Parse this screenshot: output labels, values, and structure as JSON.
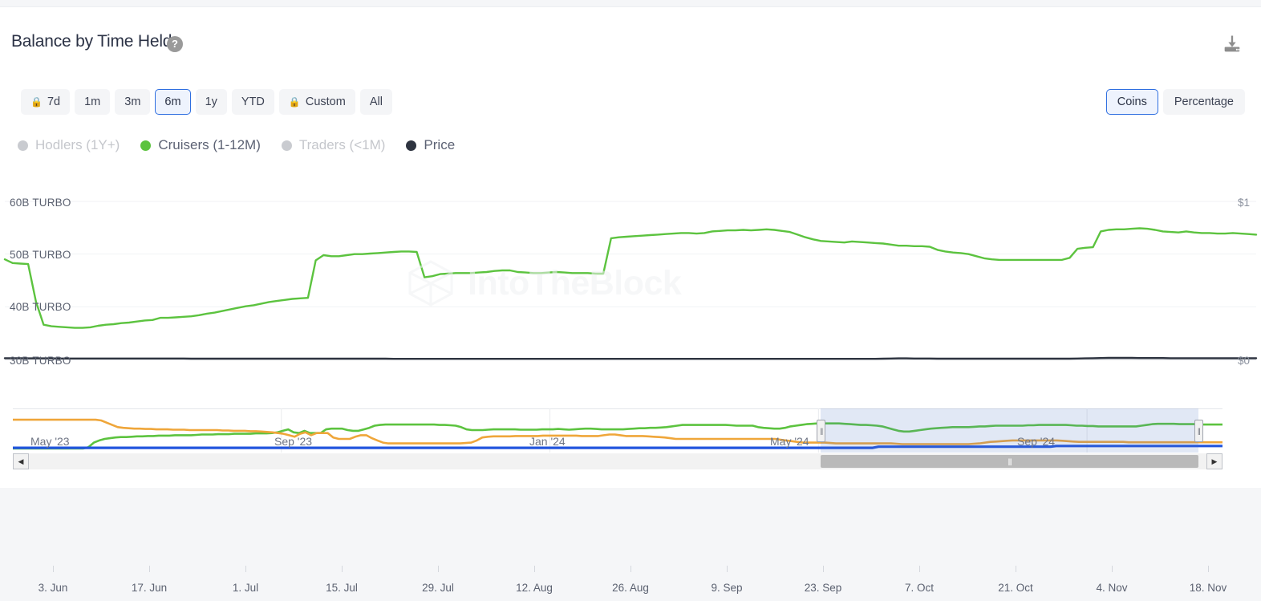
{
  "header": {
    "title": "Balance by Time Held",
    "help_icon": "question-mark-icon",
    "download_icon": "download-icon"
  },
  "toolbar": {
    "ranges": [
      {
        "label": "7d",
        "locked": true,
        "selected": false
      },
      {
        "label": "1m",
        "locked": false,
        "selected": false
      },
      {
        "label": "3m",
        "locked": false,
        "selected": false
      },
      {
        "label": "6m",
        "locked": false,
        "selected": true
      },
      {
        "label": "1y",
        "locked": false,
        "selected": false
      },
      {
        "label": "YTD",
        "locked": false,
        "selected": false
      },
      {
        "label": "Custom",
        "locked": true,
        "selected": false
      },
      {
        "label": "All",
        "locked": false,
        "selected": false
      }
    ],
    "lock_glyph": "🔒",
    "units": [
      {
        "label": "Coins",
        "selected": true
      },
      {
        "label": "Percentage",
        "selected": false
      }
    ]
  },
  "legend": [
    {
      "label": "Hodlers (1Y+)",
      "color": "#c9cbd0",
      "active": false
    },
    {
      "label": "Cruisers (1-12M)",
      "color": "#5cc33f",
      "active": true
    },
    {
      "label": "Traders (<1M)",
      "color": "#c9cbd0",
      "active": false
    },
    {
      "label": "Price",
      "color": "#2e3440",
      "active": true
    }
  ],
  "watermark": {
    "text": "IntoTheBlock"
  },
  "chart_data": {
    "type": "line",
    "title": "Balance by Time Held",
    "xlabel": "",
    "ylabel": "TURBO",
    "ylim": [
      30,
      60
    ],
    "y_ticks": [
      "30B TURBO",
      "40B TURBO",
      "50B TURBO",
      "60B TURBO"
    ],
    "y_tick_values": [
      30,
      40,
      50,
      60
    ],
    "price_axis_label": "Price",
    "price_ticks": [
      "$0",
      "$1"
    ],
    "price_tick_values": [
      0,
      1
    ],
    "price_ylim": [
      0,
      1
    ],
    "grid": true,
    "legend_position": "top-left",
    "x_ticks": [
      "3. Jun",
      "17. Jun",
      "1. Jul",
      "15. Jul",
      "29. Jul",
      "12. Aug",
      "26. Aug",
      "9. Sep",
      "23. Sep",
      "7. Oct",
      "21. Oct",
      "4. Nov",
      "18. Nov"
    ],
    "series": [
      {
        "name": "Cruisers (1-12M)",
        "color": "#5cc33f",
        "unit": "B TURBO",
        "visible": true,
        "values": [
          49.0,
          48.3,
          48.2,
          48.1,
          41.0,
          36.6,
          36.3,
          36.2,
          36.1,
          36.0,
          36.0,
          36.1,
          36.4,
          36.6,
          36.7,
          36.9,
          37.0,
          37.2,
          37.4,
          37.5,
          37.9,
          37.9,
          38.0,
          38.1,
          38.2,
          38.4,
          38.7,
          38.9,
          39.2,
          39.5,
          39.8,
          40.1,
          40.3,
          40.6,
          40.9,
          41.1,
          41.3,
          41.5,
          41.6,
          41.7,
          48.8,
          49.8,
          49.6,
          49.6,
          49.8,
          50.0,
          50.0,
          50.1,
          50.2,
          50.3,
          50.4,
          50.5,
          50.5,
          50.4,
          45.6,
          45.8,
          46.2,
          46.3,
          46.4,
          46.4,
          46.4,
          46.5,
          46.6,
          46.8,
          46.9,
          46.9,
          46.6,
          46.5,
          46.4,
          46.4,
          46.5,
          46.6,
          46.5,
          46.4,
          46.4,
          46.4,
          46.3,
          46.3,
          53.0,
          53.2,
          53.3,
          53.4,
          53.5,
          53.6,
          53.7,
          53.8,
          53.9,
          54.0,
          54.0,
          53.9,
          54.0,
          54.3,
          54.4,
          54.5,
          54.5,
          54.6,
          54.5,
          54.6,
          54.7,
          54.6,
          54.4,
          54.2,
          53.7,
          53.2,
          52.8,
          52.5,
          52.4,
          52.3,
          52.2,
          52.4,
          52.3,
          52.2,
          52.1,
          52.0,
          51.8,
          51.6,
          51.6,
          51.5,
          51.5,
          51.4,
          50.8,
          50.5,
          50.3,
          50.2,
          50.0,
          49.6,
          49.2,
          49.0,
          48.9,
          48.9,
          48.9,
          48.9,
          48.9,
          48.9,
          48.9,
          48.9,
          48.9,
          49.3,
          51.0,
          51.2,
          51.3,
          54.3,
          54.6,
          54.7,
          54.7,
          54.8,
          54.9,
          54.8,
          54.6,
          54.3,
          54.2,
          54.1,
          54.3,
          54.1,
          54.0,
          54.0,
          53.9,
          53.9,
          54.0,
          53.9,
          53.8,
          53.7
        ]
      },
      {
        "name": "Price",
        "color": "#2e3440",
        "unit": "$",
        "visible": true,
        "values": [
          0.008,
          0.008,
          0.008,
          0.007,
          0.007,
          0.007,
          0.007,
          0.006,
          0.006,
          0.006,
          0.006,
          0.006,
          0.006,
          0.006,
          0.006,
          0.006,
          0.006,
          0.006,
          0.006,
          0.006,
          0.006,
          0.006,
          0.006,
          0.006,
          0.005,
          0.005,
          0.005,
          0.005,
          0.005,
          0.005,
          0.005,
          0.005,
          0.005,
          0.005,
          0.005,
          0.005,
          0.005,
          0.005,
          0.005,
          0.005,
          0.005,
          0.005,
          0.005,
          0.005,
          0.005,
          0.005,
          0.005,
          0.005,
          0.005,
          0.005,
          0.004,
          0.004,
          0.004,
          0.004,
          0.004,
          0.004,
          0.004,
          0.004,
          0.004,
          0.004,
          0.004,
          0.004,
          0.004,
          0.004,
          0.004,
          0.004,
          0.004,
          0.004,
          0.004,
          0.004,
          0.004,
          0.004,
          0.004,
          0.004,
          0.004,
          0.004,
          0.004,
          0.004,
          0.004,
          0.004,
          0.004,
          0.004,
          0.004,
          0.004,
          0.004,
          0.004,
          0.004,
          0.004,
          0.004,
          0.004,
          0.004,
          0.004,
          0.004,
          0.004,
          0.004,
          0.004,
          0.004,
          0.004,
          0.004,
          0.004,
          0.004,
          0.004,
          0.004,
          0.004,
          0.004,
          0.004,
          0.004,
          0.004,
          0.004,
          0.004,
          0.004,
          0.004,
          0.004,
          0.005,
          0.006,
          0.007,
          0.007,
          0.006,
          0.006,
          0.006,
          0.005,
          0.005,
          0.005,
          0.005,
          0.005,
          0.005,
          0.005,
          0.005,
          0.005,
          0.005,
          0.005,
          0.005,
          0.005,
          0.005,
          0.005,
          0.005,
          0.005,
          0.005,
          0.006,
          0.007,
          0.008,
          0.009,
          0.01,
          0.01,
          0.01,
          0.01,
          0.009,
          0.009,
          0.009,
          0.009,
          0.008,
          0.008,
          0.008,
          0.008,
          0.008,
          0.008,
          0.008,
          0.008,
          0.008,
          0.008,
          0.008,
          0.008
        ]
      }
    ]
  },
  "navigator": {
    "labels": [
      "May '23",
      "Sep '23",
      "Jan '24",
      "May '24",
      "Sep '24"
    ],
    "selection_start_pct": 66.8,
    "selection_end_pct": 98.0,
    "handle_glyph": "||",
    "scrollbar": {
      "left_arrow": "◀",
      "right_arrow": "▶",
      "thumb_glyph": "|||",
      "thumb_start_pct": 66.8,
      "thumb_end_pct": 98.0
    },
    "series": [
      {
        "name": "Cruisers (1-12M)",
        "color": "#5cc33f",
        "values": [
          0,
          0,
          0,
          0,
          0,
          0,
          0,
          0,
          0,
          0,
          0,
          0,
          0,
          0,
          4,
          16,
          22,
          26,
          28,
          30,
          31,
          31,
          32,
          33,
          33,
          34,
          34,
          35,
          35,
          35,
          36,
          36,
          36,
          36,
          37,
          38,
          38,
          38,
          39,
          39,
          39,
          40,
          40,
          40,
          40,
          41,
          41,
          41,
          42,
          44,
          48,
          52,
          44,
          42,
          48,
          42,
          42,
          42,
          52,
          54,
          54,
          54,
          50,
          48,
          48,
          52,
          56,
          62,
          64,
          65,
          65,
          65,
          65,
          65,
          65,
          65,
          65,
          65,
          65,
          64,
          64,
          63,
          62,
          58,
          52,
          50,
          50,
          50,
          51,
          52,
          52,
          52,
          52,
          52,
          51,
          51,
          51,
          51,
          52,
          52,
          52,
          53,
          52,
          51,
          52,
          53,
          54,
          54,
          53,
          52,
          52,
          52,
          52,
          52,
          53,
          54,
          55,
          55,
          56,
          56,
          57,
          58,
          60,
          62,
          64,
          64,
          64,
          64,
          64,
          64,
          64,
          64,
          64,
          63,
          62,
          62,
          62,
          62,
          58,
          56,
          55,
          54,
          54,
          56,
          60,
          62,
          64,
          66,
          67,
          68,
          68,
          68,
          68,
          68,
          67,
          66,
          65,
          64,
          64,
          63,
          62,
          60,
          56,
          52,
          48,
          46,
          46,
          48,
          50,
          52,
          54,
          55,
          56,
          57,
          58,
          58,
          58,
          58,
          59,
          60,
          60,
          61,
          62,
          62,
          62,
          62,
          62,
          62,
          63,
          63,
          64,
          64,
          64,
          64,
          64,
          64,
          63,
          62,
          62,
          61,
          61,
          60,
          60,
          60,
          60,
          60,
          60,
          60,
          60,
          62,
          64,
          66,
          67,
          67,
          67,
          67,
          66,
          66,
          66,
          66,
          65,
          65,
          65,
          65,
          65
        ]
      },
      {
        "name": "Hodlers (1Y+)",
        "color": "#efa63a",
        "values": [
          78,
          78,
          78,
          78,
          78,
          78,
          78,
          78,
          78,
          78,
          78,
          78,
          78,
          78,
          78,
          78,
          76,
          70,
          64,
          58,
          56,
          55,
          54,
          54,
          53,
          53,
          52,
          52,
          52,
          51,
          51,
          51,
          50,
          50,
          50,
          50,
          50,
          50,
          49,
          49,
          48,
          48,
          48,
          47,
          47,
          46,
          45,
          44,
          42,
          40,
          36,
          32,
          40,
          44,
          36,
          42,
          42,
          42,
          30,
          26,
          26,
          26,
          32,
          36,
          36,
          28,
          22,
          16,
          14,
          14,
          14,
          14,
          14,
          14,
          14,
          14,
          14,
          14,
          14,
          14,
          14,
          14,
          15,
          16,
          22,
          30,
          32,
          33,
          33,
          33,
          33,
          34,
          34,
          34,
          34,
          34,
          35,
          35,
          35,
          35,
          35,
          35,
          35,
          34,
          34,
          34,
          34,
          36,
          38,
          38,
          36,
          34,
          34,
          34,
          34,
          33,
          32,
          31,
          30,
          28,
          26,
          26,
          26,
          26,
          26,
          26,
          26,
          26,
          26,
          26,
          26,
          26,
          26,
          26,
          26,
          26,
          26,
          26,
          26,
          24,
          22,
          20,
          18,
          16,
          16,
          16,
          16,
          16,
          15,
          14,
          14,
          14,
          14,
          14,
          14,
          14,
          14,
          14,
          14,
          14,
          13,
          12,
          12,
          12,
          12,
          12,
          12,
          12,
          12,
          12,
          12,
          12,
          12,
          12,
          13,
          14,
          16,
          18,
          19,
          20,
          21,
          22,
          22,
          22,
          22,
          22,
          22,
          22,
          22,
          22,
          21,
          20,
          19,
          18,
          18,
          18,
          18,
          18,
          18,
          18,
          18,
          18,
          17,
          17,
          17,
          17,
          17,
          17,
          17,
          17,
          17,
          17,
          17,
          17,
          17,
          17,
          17,
          17,
          17,
          17
        ]
      },
      {
        "name": "Traders (<1M)",
        "color": "#2255dd",
        "values": [
          2,
          2,
          2,
          2,
          2,
          2,
          2,
          2,
          2,
          2,
          2,
          2,
          2,
          2,
          2,
          2,
          2,
          2,
          2,
          2,
          2,
          2,
          2,
          2,
          2,
          2,
          2,
          2,
          2,
          2,
          2,
          2,
          2,
          2,
          2,
          2,
          2,
          2,
          2,
          2,
          2,
          2,
          2,
          2,
          2,
          2,
          2,
          2,
          2,
          2,
          2,
          2,
          2,
          2,
          2,
          2,
          2,
          2,
          2,
          2,
          2,
          2,
          2,
          2,
          2,
          2,
          2,
          2,
          2,
          2,
          2,
          2,
          2,
          2,
          2,
          2,
          2,
          2,
          2,
          2,
          2,
          2,
          2,
          2,
          2,
          2,
          2,
          2,
          2,
          2,
          2,
          2,
          2,
          2,
          2,
          2,
          2,
          2,
          2,
          2,
          2,
          2,
          2,
          2,
          2,
          2,
          2,
          2,
          2,
          2,
          2,
          2,
          2,
          2,
          2,
          2,
          2,
          2,
          2,
          2,
          2,
          2,
          2,
          2,
          2,
          2,
          2,
          2,
          2,
          2,
          2,
          2,
          2,
          2,
          2,
          2,
          2,
          2,
          2,
          2,
          2,
          2,
          2,
          2,
          2,
          2,
          2,
          2,
          2,
          2,
          2,
          5,
          5,
          5,
          5,
          5,
          5,
          5,
          5,
          5,
          5,
          5,
          5,
          5,
          5,
          5,
          5,
          5,
          5,
          5,
          5,
          5,
          5,
          5,
          5,
          5,
          5,
          5,
          5,
          5,
          5,
          5,
          7,
          7,
          7,
          7,
          7,
          7,
          7,
          7,
          7,
          7,
          7,
          7,
          7,
          7,
          7,
          7,
          7,
          7,
          7,
          7,
          7,
          7,
          7,
          7,
          7,
          7,
          7,
          7,
          7,
          7
        ]
      }
    ]
  }
}
